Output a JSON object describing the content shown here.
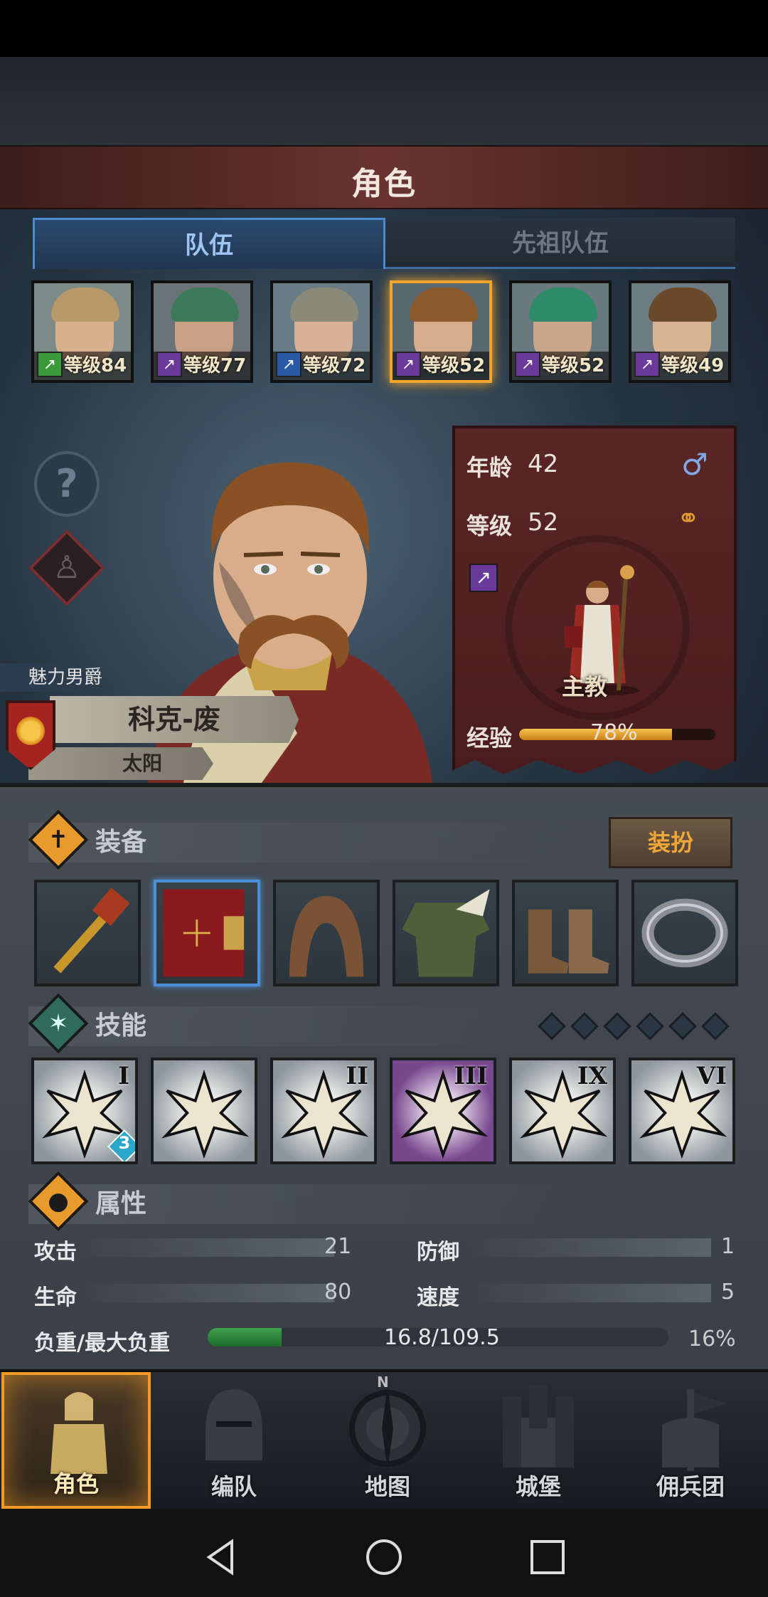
{
  "screen_title": "角色",
  "tabs": [
    {
      "label": "队伍",
      "active": true
    },
    {
      "label": "先祖队伍",
      "active": false
    }
  ],
  "party": [
    {
      "level_text": "等级84",
      "class_color": "#3a9a3a",
      "class_icon": "sword-icon",
      "hair": "#b89a6a",
      "skin": "#d9b08c",
      "bg": "#7c8a88"
    },
    {
      "level_text": "等级77",
      "class_color": "#6a3a9a",
      "class_icon": "staff-icon",
      "hair": "#3d7a5a",
      "skin": "#c9a184",
      "bg": "#6a7478"
    },
    {
      "level_text": "等级72",
      "class_color": "#2a5aa5",
      "class_icon": "dagger-icon",
      "hair": "#8a8a7a",
      "skin": "#d7b095",
      "bg": "#687c86"
    },
    {
      "level_text": "等级52",
      "class_color": "#6a3a9a",
      "class_icon": "staff-icon",
      "hair": "#8b5a2b",
      "skin": "#d6ad8c",
      "bg": "#5a6870",
      "selected": true
    },
    {
      "level_text": "等级52",
      "class_color": "#6a3a9a",
      "class_icon": "staff-icon",
      "hair": "#2f8a6a",
      "skin": "#caa58a",
      "bg": "#687a80"
    },
    {
      "level_text": "等级49",
      "class_color": "#6a3a9a",
      "class_icon": "staff-icon",
      "hair": "#6a4a2a",
      "skin": "#d8b394",
      "bg": "#6e7c84"
    }
  ],
  "hero": {
    "title": "魅力男爵",
    "name": "科克-废",
    "house": "太阳",
    "shield_color": "#a5241f"
  },
  "stats": {
    "age_label": "年龄",
    "age": "42",
    "level_label": "等级",
    "level": "52",
    "gender_icon": "male-icon",
    "class_name": "主教",
    "exp_label": "经验",
    "exp_text": "78%",
    "exp_fraction": 0.78
  },
  "equipment": {
    "label": "装备",
    "dress_button": "装扮",
    "slots": [
      {
        "name": "mace-icon",
        "selected": false
      },
      {
        "name": "book-icon",
        "selected": true
      },
      {
        "name": "hood-icon",
        "selected": false
      },
      {
        "name": "tunic-icon",
        "selected": false
      },
      {
        "name": "boots-icon",
        "selected": false
      },
      {
        "name": "ring-icon",
        "selected": false
      }
    ]
  },
  "skills": {
    "label": "技能",
    "items": [
      {
        "name": "drain-skill-icon",
        "rank": "I",
        "badge": "3",
        "purple": false
      },
      {
        "name": "heal-skill-icon",
        "rank": "",
        "badge": "",
        "purple": false
      },
      {
        "name": "crystal-hand-skill-icon",
        "rank": "II",
        "badge": "",
        "purple": false
      },
      {
        "name": "burst-skill-icon",
        "rank": "III",
        "badge": "",
        "purple": true
      },
      {
        "name": "shatter-skill-icon",
        "rank": "IX",
        "badge": "",
        "purple": false
      },
      {
        "name": "explosion-skill-icon",
        "rank": "VI",
        "badge": "",
        "purple": false
      }
    ]
  },
  "attributes": {
    "label": "属性",
    "attack_label": "攻击",
    "attack": "21",
    "defense_label": "防御",
    "defense": "1",
    "hp_label": "生命",
    "hp": "80",
    "speed_label": "速度",
    "speed": "5",
    "load_label": "负重/最大负重",
    "load_text": "16.8/109.5",
    "load_percent": "16%",
    "load_fraction": 0.16
  },
  "nav": [
    {
      "label": "角色",
      "icon": "knight-icon",
      "selected": true
    },
    {
      "label": "编队",
      "icon": "helmet-icon",
      "selected": false
    },
    {
      "label": "地图",
      "icon": "compass-icon",
      "selected": false
    },
    {
      "label": "城堡",
      "icon": "castle-icon",
      "selected": false
    },
    {
      "label": "佣兵团",
      "icon": "flag-icon",
      "selected": false
    }
  ],
  "compass_n": "N"
}
